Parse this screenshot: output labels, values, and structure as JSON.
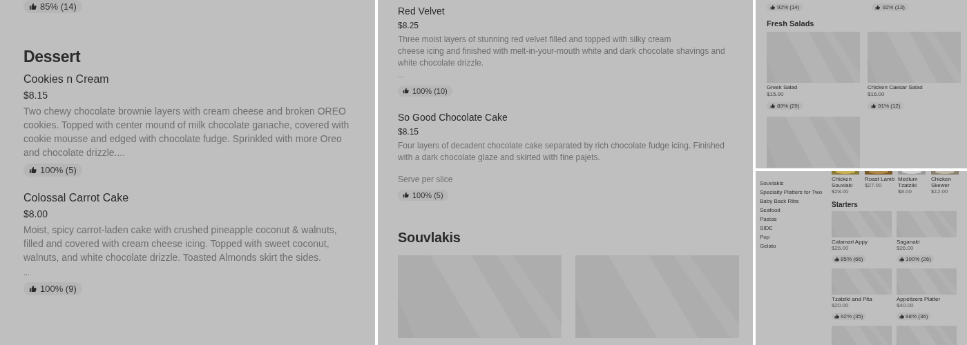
{
  "panel_1": {
    "top_rating": "85% (14)",
    "section": "Dessert",
    "items": [
      {
        "name": "Cookies n Cream",
        "price": "$8.15",
        "description": "Two chewy chocolate brownie layers with cream cheese and broken OREO cookies. Topped with center mound of milk chocolate ganache, covered with cookie mousse and edged with chocolate fudge. Sprinkled with more Oreo and chocolate drizzle....",
        "rating": "100% (5)"
      },
      {
        "name": "Colossal Carrot Cake",
        "price": "$8.00",
        "description": "Moist, spicy carrot-laden cake with crushed pineapple coconut & walnuts, filled and covered with cream cheese icing. Topped with sweet coconut, walnuts, and white chocolate drizzle. Toasted Almonds skirt the sides.",
        "more": "...",
        "rating": "100% (9)"
      }
    ]
  },
  "panel_2": {
    "items": [
      {
        "name": "Red Velvet",
        "price": "$8.25",
        "description": "Three moist layers of stunning red velvet filled and topped with silky cream\ncheese icing and finished with melt-in-your-mouth white and dark chocolate shavings and white chocolate drizzle.",
        "more": "...",
        "rating": "100% (10)"
      },
      {
        "name": "So Good Chocolate Cake",
        "price": "$8.15",
        "description": "Four layers of decadent chocolate cake separated by rich chocolate fudge icing. Finished with a dark chocolate glaze and skirted with fine pajets.",
        "note": "Serve per slice",
        "rating": "100% (5)"
      }
    ],
    "section": "Souvlakis",
    "pictures": [
      {
        "kind": "picture"
      },
      {
        "kind": "picture"
      }
    ]
  },
  "panel_3": {
    "top_ratings": [
      "92% (14)",
      "92% (13)"
    ],
    "section": "Fresh Salads",
    "cards": [
      {
        "kind": "item",
        "name": "Greek Salad",
        "price": "$15.00",
        "rating": "89% (29)"
      },
      {
        "kind": "item",
        "name": "Chicken Caesar Salad",
        "price": "$16.00",
        "rating": "91% (12)"
      },
      {
        "kind": "picture"
      }
    ]
  },
  "panel_4": {
    "sidebar": [
      "Souvlakis",
      "Specialty Platters for Two",
      "Baby Back Ribs",
      "Seafood",
      "Pastas",
      "SIDE",
      "Pop",
      "Gelato"
    ],
    "top_row": [
      {
        "name": "Chicken Souvlaki",
        "price": "$28.00"
      },
      {
        "name": "Roast Lamb",
        "price": "$27.00"
      },
      {
        "name": "Medium Tzatziki",
        "price": "$8.00"
      },
      {
        "name": "Chicken Skewer",
        "price": "$12.00"
      }
    ],
    "section": "Starters",
    "cards": [
      {
        "kind": "item",
        "name": "Calamari Appy",
        "price": "$26.00",
        "rating": "85% (66)"
      },
      {
        "kind": "item",
        "name": "Saganaki",
        "price": "$26.00",
        "rating": "100% (26)"
      },
      {
        "kind": "item",
        "name": "Tzatziki and Pita",
        "price": "$20.00",
        "rating": "92% (35)"
      },
      {
        "kind": "item",
        "name": "Appetizers Platter",
        "price": "$40.00",
        "rating": "98% (36)"
      },
      {
        "kind": "picture"
      },
      {
        "kind": "picture"
      }
    ]
  }
}
